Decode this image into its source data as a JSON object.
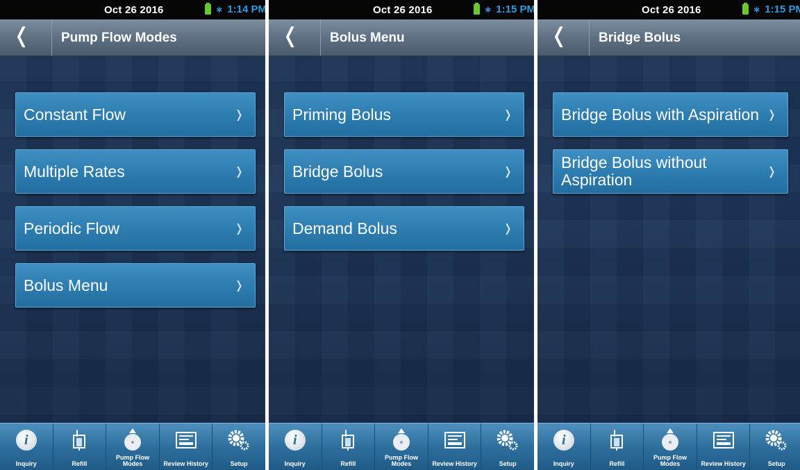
{
  "screens": [
    {
      "status": {
        "date": "Oct 26 2016",
        "time": "1:14 PM"
      },
      "title": "Pump Flow Modes",
      "items": [
        {
          "label": "Constant Flow"
        },
        {
          "label": "Multiple Rates"
        },
        {
          "label": "Periodic Flow"
        },
        {
          "label": "Bolus Menu"
        }
      ]
    },
    {
      "status": {
        "date": "Oct 26 2016",
        "time": "1:15 PM"
      },
      "title": "Bolus Menu",
      "items": [
        {
          "label": "Priming Bolus"
        },
        {
          "label": "Bridge Bolus"
        },
        {
          "label": "Demand Bolus"
        }
      ]
    },
    {
      "status": {
        "date": "Oct 26 2016",
        "time": "1:15 PM"
      },
      "title": "Bridge Bolus",
      "items": [
        {
          "label": "Bridge Bolus with Aspiration"
        },
        {
          "label": "Bridge Bolus without Aspiration"
        }
      ]
    }
  ],
  "tabs": {
    "inquiry": "Inquiry",
    "refill": "Refill",
    "pump_flow_modes": "Pump Flow Modes",
    "review_history": "Review History",
    "setup": "Setup"
  },
  "icons": {
    "back": "back-chevron-icon",
    "chevron": "chevron-right-icon",
    "battery": "battery-icon",
    "bluetooth": "bluetooth-icon",
    "inquiry": "info-icon",
    "refill": "syringe-icon",
    "pump_flow_modes": "pump-icon",
    "review_history": "history-screen-icon",
    "setup": "gears-icon"
  },
  "colors": {
    "background": "#1d3558",
    "menu_button": "#2f7fb3",
    "titlebar": "#5e7083",
    "time": "#2f9be0",
    "battery": "#68c82e"
  }
}
